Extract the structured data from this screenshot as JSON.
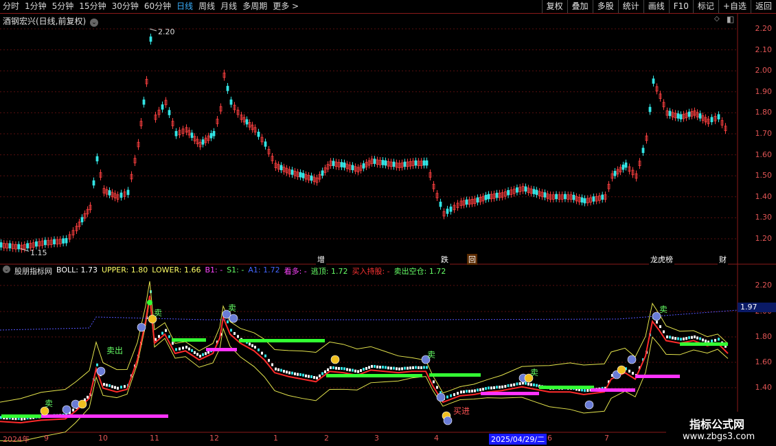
{
  "toolbar": {
    "items": [
      "分时",
      "1分钟",
      "5分钟",
      "15分钟",
      "30分钟",
      "60分钟",
      "日线",
      "周线",
      "月线",
      "多周期",
      "更多 >"
    ],
    "active_index": 6,
    "buttons": [
      "复权",
      "叠加",
      "多股",
      "统计",
      "画线",
      "F10",
      "标记",
      "+自选",
      "返回"
    ]
  },
  "main_panel": {
    "title": "酒钢宏兴(日线,前复权)",
    "axis_labels": [
      "2.20",
      "2.10",
      "2.00",
      "1.90",
      "1.80",
      "1.70",
      "1.60",
      "1.50",
      "1.40",
      "1.30",
      "1.20"
    ],
    "high_label": "2.20",
    "low_label": "1.15",
    "events": [
      {
        "text": "增",
        "color": "#ffffff",
        "bg": "#000"
      },
      {
        "text": "跌",
        "color": "#ffffff",
        "bg": "#000"
      },
      {
        "text": "回",
        "color": "#ffffff",
        "bg": "#5a2a00"
      },
      {
        "text": "龙虎榜",
        "color": "#ffffff",
        "bg": "#000"
      },
      {
        "text": "财",
        "color": "#ffffff",
        "bg": "#000"
      }
    ]
  },
  "indicator_panel": {
    "name": "股朋指标网",
    "legend": [
      {
        "label": "BOLL: 1.73",
        "color": "#ffffff"
      },
      {
        "label": "UPPER: 1.80",
        "color": "#ffff66"
      },
      {
        "label": "LOWER: 1.66",
        "color": "#ffff66"
      },
      {
        "label": "B1: -",
        "color": "#ff44ff"
      },
      {
        "label": "S1: -",
        "color": "#66ff66"
      },
      {
        "label": "A1: 1.72",
        "color": "#4466ff"
      },
      {
        "label": "看多: -",
        "color": "#ff44ff"
      },
      {
        "label": "逃顶: 1.72",
        "color": "#66ff66"
      },
      {
        "label": "买入持股: -",
        "color": "#ff3333"
      },
      {
        "label": "卖出空仓: 1.72",
        "color": "#66ff66"
      }
    ],
    "axis_labels": [
      "2.20",
      "2.00",
      "1.80",
      "1.60",
      "1.40"
    ],
    "current_price": "1.97",
    "annotations": [
      "卖出",
      "卖",
      "卖",
      "卖",
      "卖",
      "买进",
      "卖",
      "卖"
    ]
  },
  "date_axis": {
    "labels": [
      "2024年",
      "9",
      "10",
      "11",
      "12",
      "1",
      "2",
      "3",
      "4",
      "2025/04/29/二",
      "6",
      "7"
    ],
    "highlight_index": 9
  },
  "watermark": {
    "line1": "指标公式网",
    "line2": "www.zbgs3.com"
  }
}
